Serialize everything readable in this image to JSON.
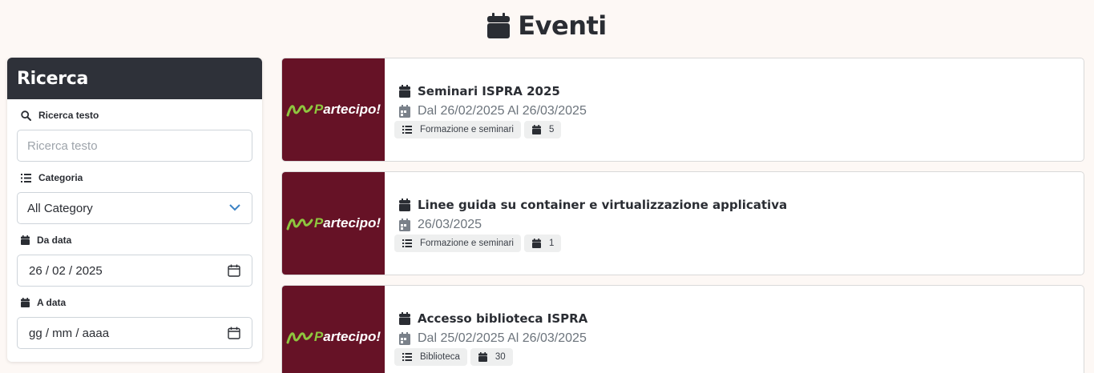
{
  "page": {
    "title": "Eventi",
    "icon": "calendar-icon"
  },
  "sidebar": {
    "title": "Ricerca",
    "search": {
      "label": "Ricerca testo",
      "icon": "search-icon",
      "placeholder": "Ricerca testo"
    },
    "category": {
      "label": "Categoria",
      "icon": "list-icon",
      "selected": "All Category"
    },
    "date_from": {
      "label": "Da data",
      "icon": "calendar-icon",
      "value": "26 / 02 / 2025"
    },
    "date_to": {
      "label": "A data",
      "icon": "calendar-icon",
      "placeholder": "gg / mm / aaaa"
    }
  },
  "brand": {
    "first_letter": "P",
    "rest": "artecipo!",
    "accent_color": "#8ec63f",
    "background": "#661226"
  },
  "events": [
    {
      "title": "Seminari ISPRA 2025",
      "date": "Dal 26/02/2025 Al 26/03/2025",
      "category": "Formazione e seminari",
      "count": "5"
    },
    {
      "title": "Linee guida su container e virtualizzazione applicativa",
      "date": "26/03/2025",
      "category": "Formazione e seminari",
      "count": "1"
    },
    {
      "title": "Accesso biblioteca ISPRA",
      "date": "Dal 25/02/2025 Al 26/03/2025",
      "category": "Biblioteca",
      "count": "30"
    }
  ]
}
